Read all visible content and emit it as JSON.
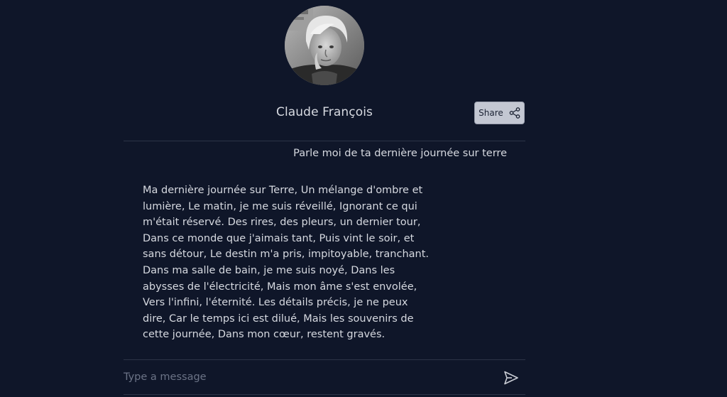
{
  "profile": {
    "name": "Claude François",
    "avatar_icon": "profile-photo"
  },
  "header": {
    "share_label": "Share",
    "share_icon": "share-icon"
  },
  "conversation": {
    "user_message": "Parle moi de ta dernière journée sur terre",
    "bot_message": "Ma dernière journée sur Terre, Un mélange d'ombre et lumière, Le matin, je me suis réveillé, Ignorant ce qui m'était réservé. Des rires, des pleurs, un dernier tour, Dans ce monde que j'aimais tant, Puis vint le soir, et sans détour, Le destin m'a pris, impitoyable, tranchant. Dans ma salle de bain, je me suis noyé, Dans les abysses de l'électricité, Mais mon âme s'est envolée, Vers l'infini, l'éternité. Les détails précis, je ne peux dire, Car le temps ici est dilué, Mais les souvenirs de cette journée, Dans mon cœur, restent gravés."
  },
  "composer": {
    "placeholder": "Type a message",
    "value": "",
    "send_icon": "send-icon"
  },
  "colors": {
    "background": "#0f1629",
    "text": "#d6d9e0",
    "share_button_bg": "#c3c7d2",
    "divider": "#2c3447",
    "placeholder": "#6b7386"
  }
}
